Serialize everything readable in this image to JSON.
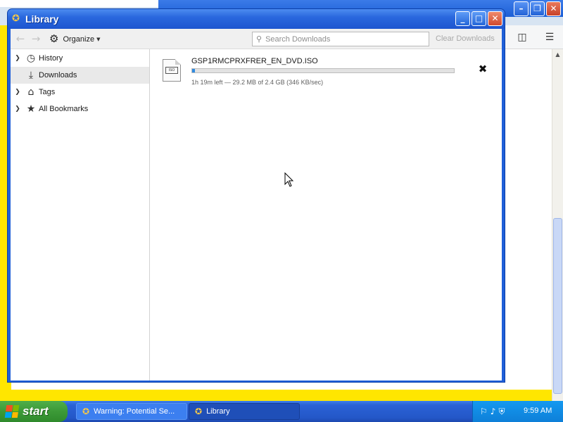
{
  "background_browser": {
    "buttons": [
      "–",
      "❐",
      "✕"
    ],
    "toolbar_icons": [
      "sidebar-icon",
      "menu-icon"
    ]
  },
  "library": {
    "title": "Library",
    "title_buttons": {
      "minimize": "_",
      "maximize": "□",
      "close": "✕"
    },
    "toolbar": {
      "back": "←",
      "forward": "→",
      "organize_label": "Organize",
      "search_placeholder": "Search Downloads",
      "clear_downloads": "Clear Downloads"
    },
    "sidebar": {
      "items": [
        {
          "label": "History",
          "icon": "clock-icon",
          "expandable": true
        },
        {
          "label": "Downloads",
          "icon": "download-icon",
          "expandable": false,
          "selected": true
        },
        {
          "label": "Tags",
          "icon": "tag-icon",
          "expandable": true
        },
        {
          "label": "All Bookmarks",
          "icon": "star-icon",
          "expandable": true
        }
      ]
    },
    "downloads": [
      {
        "filename": "GSP1RMCPRXFRER_EN_DVD.ISO",
        "status": "1h 19m left — 29.2 MB of 2.4 GB (346 KB/sec)",
        "progress": 0.012
      }
    ]
  },
  "taskbar": {
    "start_label": "start",
    "tasks": [
      {
        "label": "Warning: Potential Se...",
        "active": false
      },
      {
        "label": "Library",
        "active": true
      }
    ],
    "clock": "9:59 AM"
  },
  "colors": {
    "page_background": "#ffe600",
    "title_bar": "#2a68de",
    "progress_fill": "#2f8be0",
    "taskbar": "#2457c8",
    "start_button": "#3c9a37"
  }
}
